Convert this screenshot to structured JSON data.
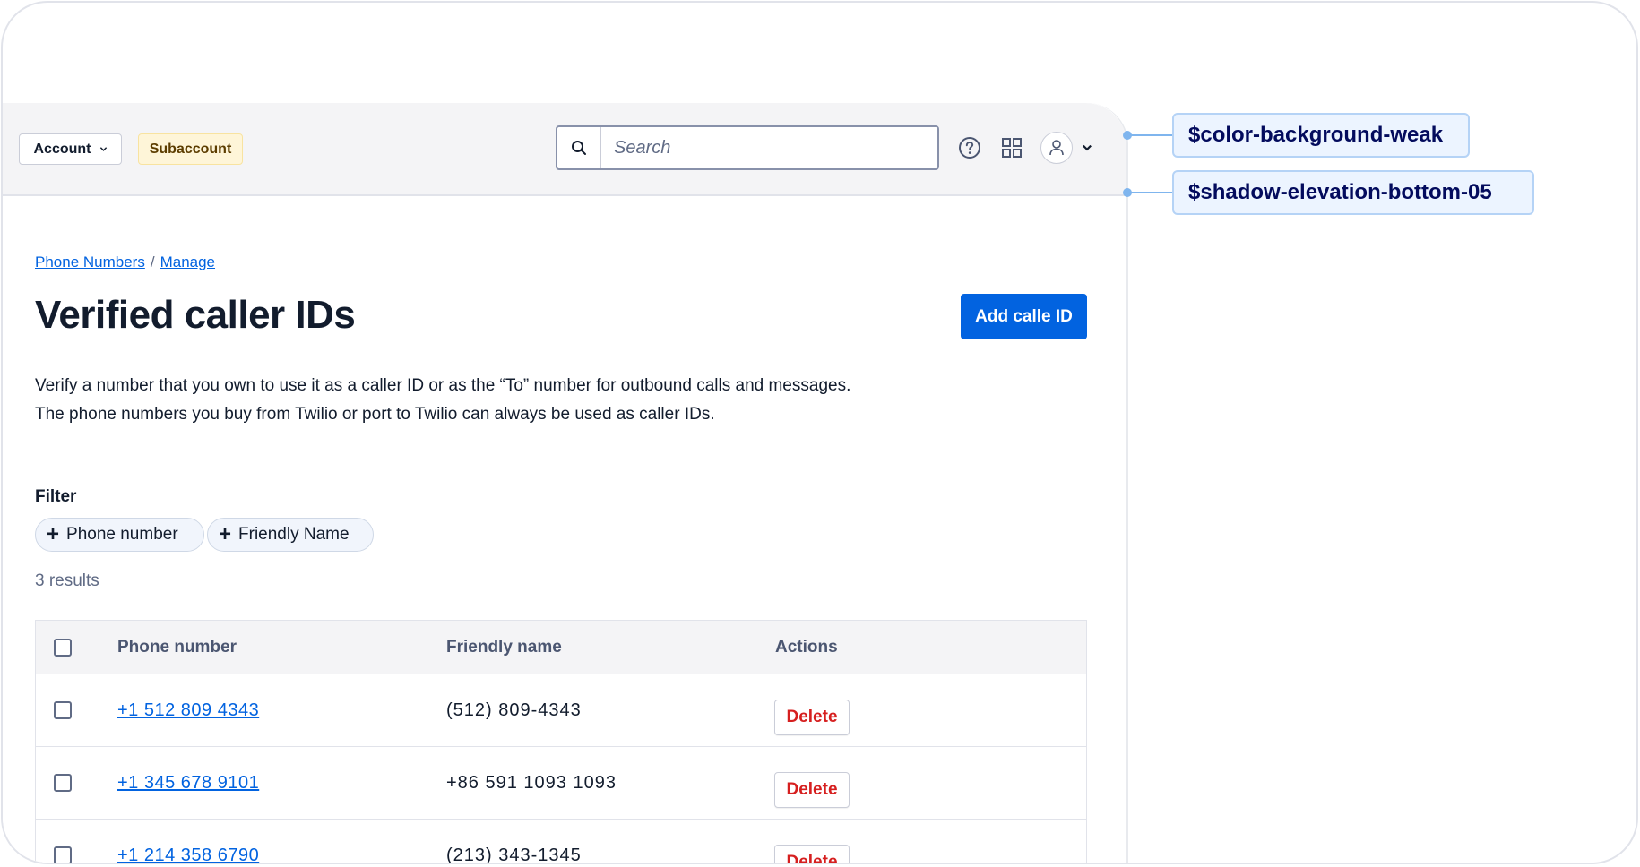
{
  "topbar": {
    "account_label": "Account",
    "subaccount_badge": "Subaccount",
    "search_placeholder": "Search",
    "icons": [
      "search-icon",
      "help-icon",
      "app-grid-icon",
      "user-avatar-icon",
      "chevron-down-icon"
    ]
  },
  "breadcrumb": {
    "items": [
      "Phone Numbers",
      "Manage"
    ],
    "separator": "/"
  },
  "page": {
    "title": "Verified caller IDs",
    "primary_action": "Add calle ID",
    "description_line1": "Verify a number that you own to use it as a caller ID or as the “To” number for outbound calls and messages.",
    "description_line2": "The phone numbers you buy from Twilio or port to Twilio can always be used as caller IDs."
  },
  "filter": {
    "label": "Filter",
    "chips": [
      "Phone number",
      "Friendly Name"
    ]
  },
  "results_text": "3 results",
  "table": {
    "headers": [
      "Phone number",
      "Friendly name",
      "Actions"
    ],
    "rows": [
      {
        "phone": "+1 512 809 4343",
        "friendly": "(512) 809-4343",
        "action": "Delete"
      },
      {
        "phone": "+1 345 678 9101",
        "friendly": "+86 591 1093 1093",
        "action": "Delete"
      },
      {
        "phone": "+1 214 358 6790",
        "friendly": "(213) 343-1345",
        "action": "Delete"
      }
    ]
  },
  "annotations": [
    "$color-background-weak",
    "$shadow-elevation-bottom-05"
  ],
  "colors": {
    "primary": "#0263e0",
    "destructive": "#d61f1f",
    "topbar_background": "#f4f4f6",
    "badge_background": "#fef5d8",
    "annotation_accent": "#7fb5ee"
  }
}
